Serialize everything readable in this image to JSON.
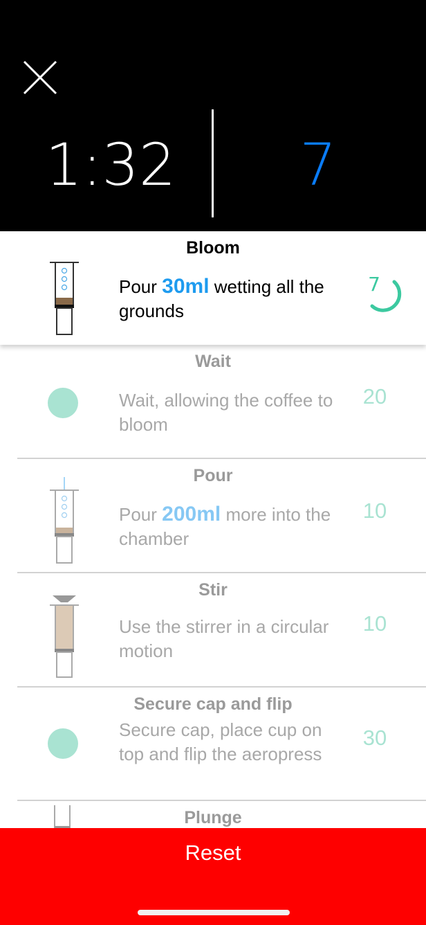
{
  "header": {
    "close_icon": "close-icon",
    "timer": "1:32",
    "countdown": "7",
    "countdown_color": "#0a7cf7"
  },
  "steps": [
    {
      "title": "Bloom",
      "desc_prefix": "Pour ",
      "highlight": "30ml",
      "desc_suffix": " wetting all the grounds",
      "time": "7",
      "icon": "aeropress-bloom-icon",
      "active": true,
      "progress_fraction": 0.25
    },
    {
      "title": "Wait",
      "desc": "Wait, allowing the coffee to bloom",
      "time": "20",
      "icon": "dot-icon"
    },
    {
      "title": "Pour",
      "desc_prefix": "Pour ",
      "highlight": "200ml",
      "desc_suffix": " more into the chamber",
      "time": "10",
      "icon": "aeropress-pour-icon"
    },
    {
      "title": "Stir",
      "desc": "Use the stirrer in a circular motion",
      "time": "10",
      "icon": "aeropress-stir-icon"
    },
    {
      "title": "Secure cap and flip",
      "desc": "Secure cap, place cup on top and flip the aeropress",
      "time": "30",
      "icon": "dot-icon"
    },
    {
      "title": "Plunge",
      "icon": "aeropress-plunge-icon"
    }
  ],
  "footer": {
    "reset_label": "Reset",
    "reset_color": "#fe0000"
  }
}
